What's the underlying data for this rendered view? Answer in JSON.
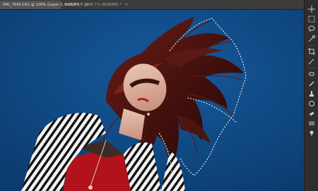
{
  "tabs": [
    {
      "label": "IMG_7645.CR2 @ 100% (Layer 2, RGB/8*) *",
      "active": true
    },
    {
      "label": "Untitled-1 @ 66.7% (RGB/8#) *",
      "active": false
    }
  ],
  "tab_close_glyph": "×",
  "tools": [
    "move-tool-icon",
    "marquee-tool-icon",
    "lasso-tool-icon",
    "quick-select-tool-icon",
    "crop-tool-icon",
    "eyedropper-tool-icon",
    "healing-brush-icon",
    "brush-tool-icon",
    "clone-stamp-icon",
    "history-brush-icon",
    "eraser-tool-icon",
    "gradient-tool-icon",
    "dodge-tool-icon"
  ],
  "colors": {
    "canvas_background": "#0f4a83",
    "tabbar": "#3c3c3c",
    "active_tab": "#535353",
    "panel": "#2e2e2e",
    "selection_marquee": "#ffffff"
  },
  "canvas": {
    "image_subject": "woman with red hair flipping her hair against a blue backdrop, wearing a zebra-striped jacket and red top"
  }
}
